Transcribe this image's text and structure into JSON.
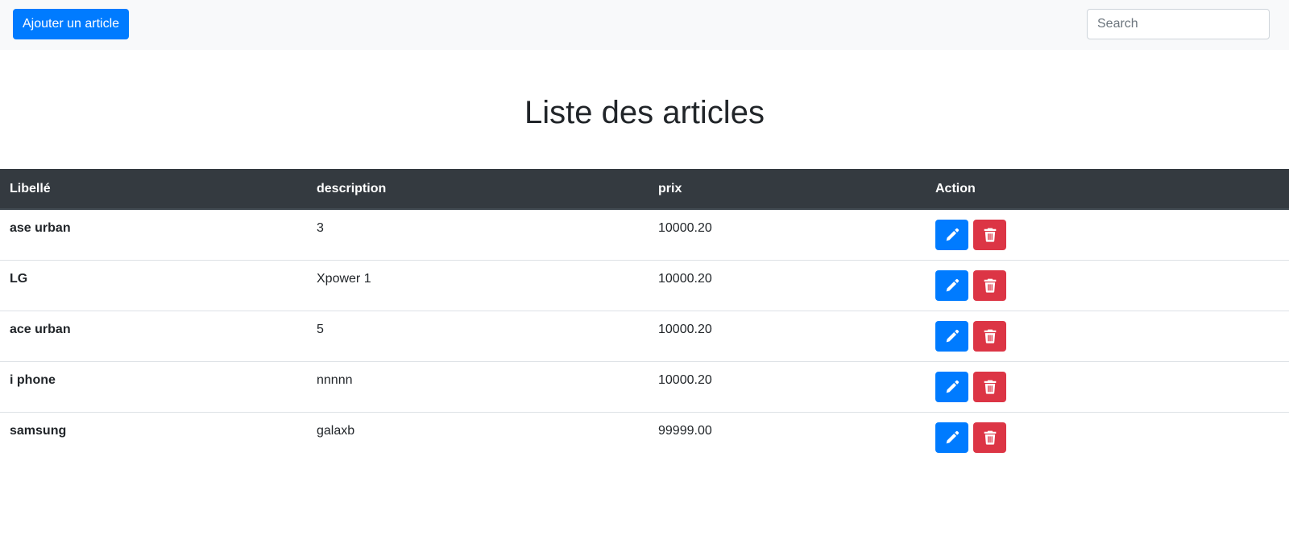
{
  "navbar": {
    "add_label": "Ajouter un article",
    "search_placeholder": "Search",
    "search_value": ""
  },
  "page": {
    "title": "Liste des articles"
  },
  "table": {
    "headers": [
      "Libellé",
      "description",
      "prix",
      "Action"
    ],
    "rows": [
      {
        "libelle": "ase urban",
        "description": "3",
        "prix": "10000.20"
      },
      {
        "libelle": "LG",
        "description": "Xpower 1",
        "prix": "10000.20"
      },
      {
        "libelle": "ace urban",
        "description": "5",
        "prix": "10000.20"
      },
      {
        "libelle": "i phone",
        "description": "nnnnn",
        "prix": "10000.20"
      },
      {
        "libelle": "samsung",
        "description": "galaxb",
        "prix": "99999.00"
      }
    ]
  },
  "icons": {
    "edit": "pencil-icon",
    "delete": "trash-icon"
  },
  "colors": {
    "primary": "#007bff",
    "danger": "#dc3545",
    "table_header": "#343a40",
    "navbar_bg": "#f8f9fa"
  }
}
